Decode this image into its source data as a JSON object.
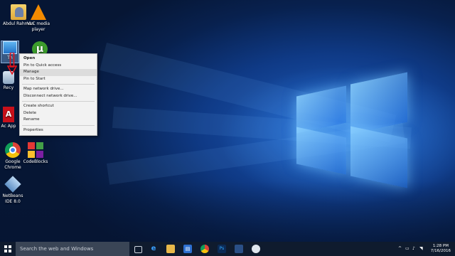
{
  "desktop_icons": {
    "abdul": "Abdul Rahman",
    "vlc": "VLC media player",
    "thispc": "Th",
    "recycle": "Recy",
    "acrobat": "Ac App",
    "chrome": "Google Chrome",
    "codeblocks": "CodeBlocks",
    "netbeans": "NetBeans IDE 8.0"
  },
  "context_menu": {
    "items": [
      "Open",
      "Pin to Quick access",
      "Manage",
      "Pin to Start",
      "Map network drive...",
      "Disconnect network drive...",
      "Create shortcut",
      "Delete",
      "Rename",
      "Properties"
    ]
  },
  "taskbar": {
    "search_placeholder": "Search the web and Windows",
    "time": "1:28 PM",
    "date": "7/16/2016"
  },
  "colors": {
    "taskbar": "#0f1b2e",
    "menu_bg": "#f2f2f2",
    "arrow": "#e0141c"
  }
}
